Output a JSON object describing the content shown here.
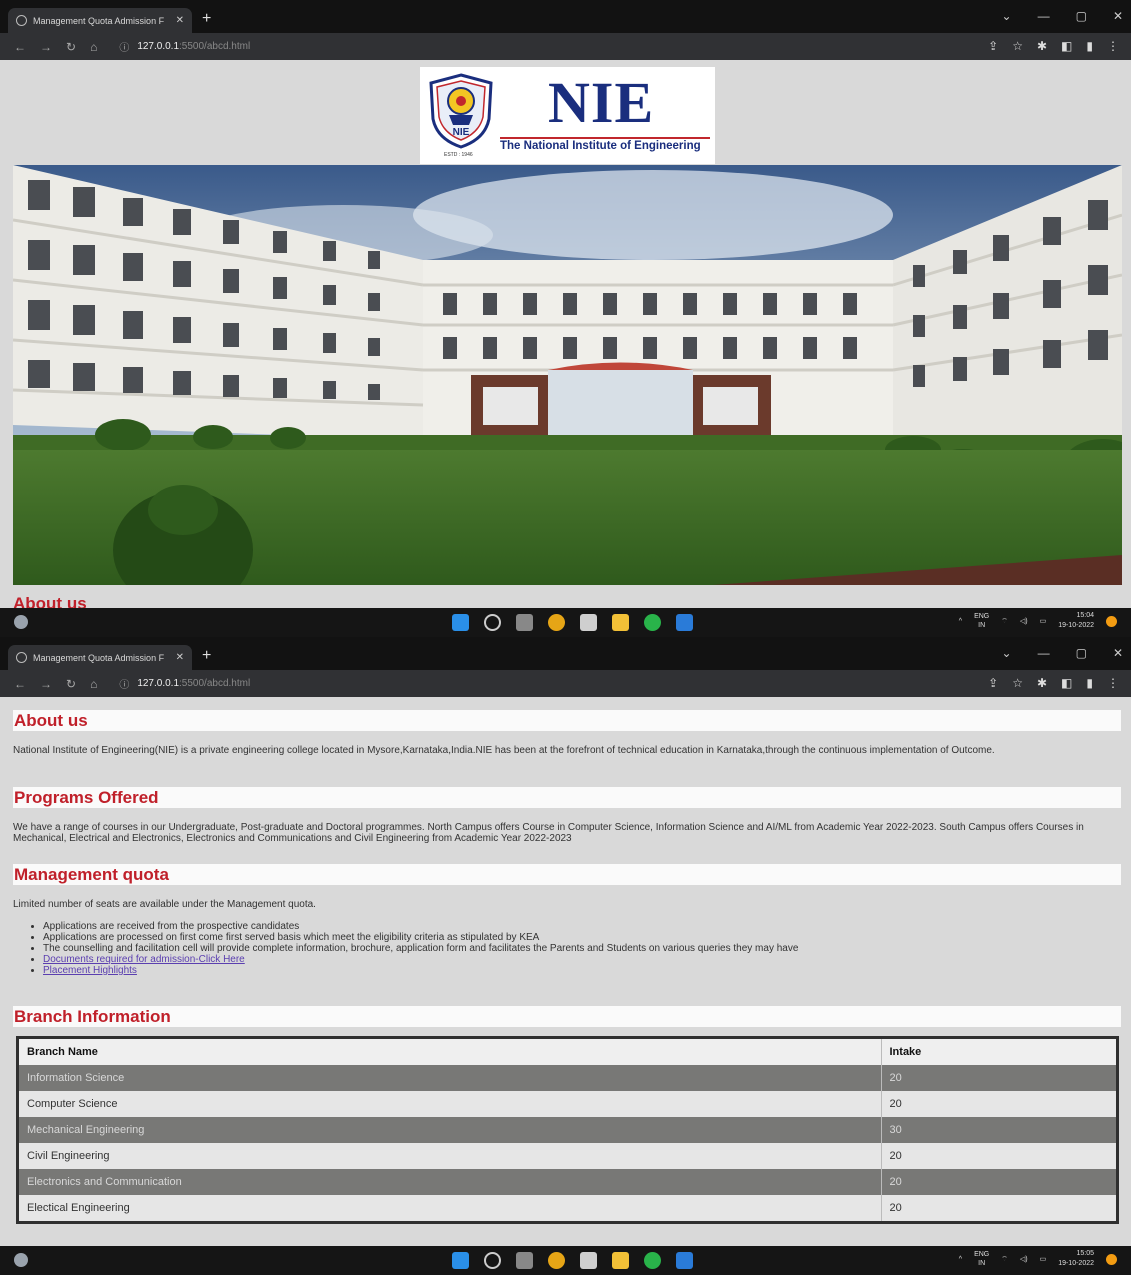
{
  "browser": {
    "tab_title": "Management Quota Admission F",
    "url_host": "127.0.0.1",
    "url_path": ":5500/abcd.html"
  },
  "logo": {
    "name": "NIE",
    "full_name": "The National Institute of Engineering",
    "established": "ESTD : 1946"
  },
  "page": {
    "peek_heading": "About us",
    "about": {
      "heading": "About us",
      "text": "National Institute of Engineering(NIE) is a private engineering college located in Mysore,Karnataka,India.NIE has been at the forefront of technical education in Karnataka,through the continuous implementation of Outcome."
    },
    "programs": {
      "heading": "Programs Offered",
      "text": "We have a range of courses in our Undergraduate, Post-graduate and Doctoral programmes. North Campus offers Course in Computer Science, Information Science and AI/ML from Academic Year 2022-2023. South Campus offers Courses in Mechanical, Electrical and Electronics, Electronics and Communications and Civil Engineering from Academic Year 2022-2023"
    },
    "quota": {
      "heading": "Management quota",
      "intro": "Limited number of seats are available under the Management quota.",
      "bullets": [
        "Applications are received from the prospective candidates",
        "Applications are processed on first come first served basis which meet the eligibility criteria as stipulated by KEA",
        "The counselling and facilitation cell will provide complete information, brochure, application form and facilitates the Parents and Students on various queries they may have"
      ],
      "links": [
        "Documents required for admission-Click Here",
        "Placement Highlights"
      ]
    },
    "branch": {
      "heading": "Branch Information",
      "col_name": "Branch Name",
      "col_intake": "Intake",
      "rows": [
        {
          "name": "Information Science",
          "intake": "20"
        },
        {
          "name": "Computer Science",
          "intake": "20"
        },
        {
          "name": "Mechanical Engineering",
          "intake": "30"
        },
        {
          "name": "Civil Engineering",
          "intake": "20"
        },
        {
          "name": "Electronics and Communication",
          "intake": "20"
        },
        {
          "name": "Electical Engineering",
          "intake": "20"
        }
      ]
    }
  },
  "taskbar": {
    "lang_top": "ENG",
    "lang_bottom": "IN",
    "time1": "15:04",
    "date1": "19-10-2022",
    "time2": "15:05",
    "date2": "19-10-2022"
  }
}
